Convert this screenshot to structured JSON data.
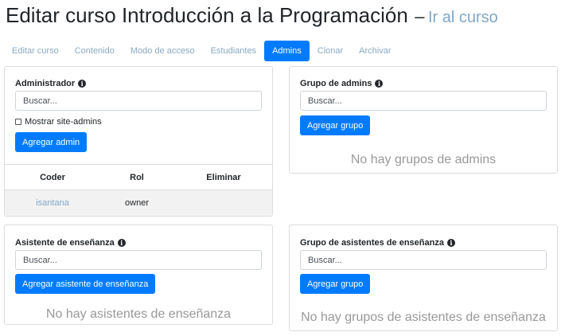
{
  "header": {
    "title": "Editar curso Introducción a la Programación",
    "separator": "–",
    "link": "Ir al curso"
  },
  "tabs": [
    {
      "label": "Editar curso",
      "active": false
    },
    {
      "label": "Contenido",
      "active": false
    },
    {
      "label": "Modo de acceso",
      "active": false
    },
    {
      "label": "Estudiantes",
      "active": false
    },
    {
      "label": "Admins",
      "active": true
    },
    {
      "label": "Clonar",
      "active": false
    },
    {
      "label": "Archivar",
      "active": false
    }
  ],
  "admin_panel": {
    "title": "Administrador",
    "search_placeholder": "Buscar...",
    "show_site_admins_label": "Mostrar site-admins",
    "add_button": "Agregar admin",
    "columns": [
      "Coder",
      "Rol",
      "Eliminar"
    ],
    "rows": [
      {
        "coder": "isantana",
        "role": "owner",
        "delete": ""
      }
    ]
  },
  "admin_groups_panel": {
    "title": "Grupo de admins",
    "search_placeholder": "Buscar...",
    "add_button": "Agregar grupo",
    "empty_text": "No hay grupos de admins"
  },
  "teaching_assistant_panel": {
    "title": "Asistente de enseñanza",
    "search_placeholder": "Buscar...",
    "add_button": "Agregar asistente de enseñanza",
    "empty_text": "No hay asistentes de enseñanza"
  },
  "teaching_assistant_groups_panel": {
    "title": "Grupo de asistentes de enseñanza",
    "search_placeholder": "Buscar...",
    "add_button": "Agregar grupo",
    "empty_text": "No hay grupos de asistentes de enseñanza"
  },
  "colors": {
    "primary": "#007bff",
    "link": "#7fa8c9",
    "muted": "#999999"
  }
}
